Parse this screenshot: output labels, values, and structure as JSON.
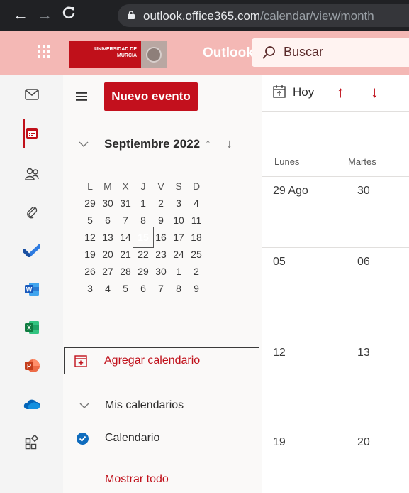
{
  "browser": {
    "url_domain": "outlook.office365.com",
    "url_path": "/calendar/view/month"
  },
  "header": {
    "logo_text_line1": "UNIVERSIDAD DE",
    "logo_text_line2": "MURCIA",
    "brand": "Outlook",
    "search_placeholder": "Buscar"
  },
  "folder_pane": {
    "new_event_label": "Nuevo evento",
    "mini_calendar": {
      "month_label": "Septiembre 2022",
      "weekday_headers": [
        "L",
        "M",
        "X",
        "J",
        "V",
        "S",
        "D"
      ],
      "weeks": [
        [
          "29",
          "30",
          "31",
          "1",
          "2",
          "3",
          "4"
        ],
        [
          "5",
          "6",
          "7",
          "8",
          "9",
          "10",
          "11"
        ],
        [
          "12",
          "13",
          "14",
          "15",
          "16",
          "17",
          "18"
        ],
        [
          "19",
          "20",
          "21",
          "22",
          "23",
          "24",
          "25"
        ],
        [
          "26",
          "27",
          "28",
          "29",
          "30",
          "1",
          "2"
        ],
        [
          "3",
          "4",
          "5",
          "6",
          "7",
          "8",
          "9"
        ]
      ],
      "today": "15"
    },
    "add_calendar_label": "Agregar calendario",
    "my_calendars_label": "Mis calendarios",
    "calendar_item_label": "Calendario",
    "show_all_label": "Mostrar todo"
  },
  "main": {
    "today_label": "Hoy",
    "day_headers": [
      "Lunes",
      "Martes"
    ],
    "weeks": [
      [
        "29 Ago",
        "30"
      ],
      [
        "05",
        "06"
      ],
      [
        "12",
        "13"
      ],
      [
        "19",
        "20"
      ]
    ]
  },
  "colors": {
    "brand_red": "#c0101a",
    "header_pink": "#f4b8b5"
  }
}
